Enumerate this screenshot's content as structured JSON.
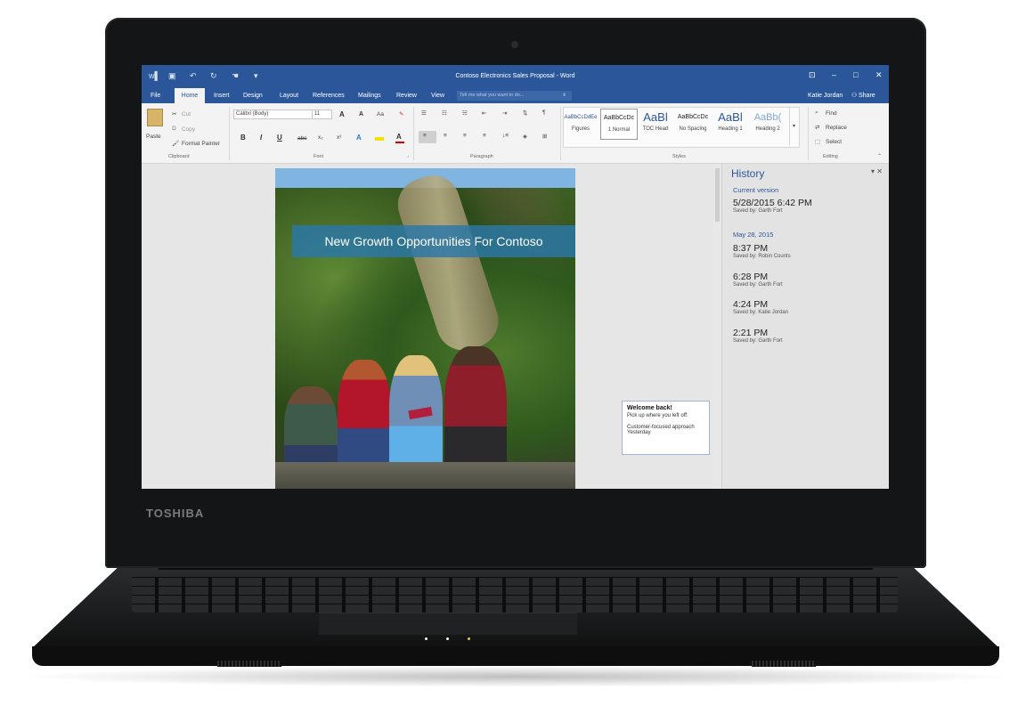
{
  "device": {
    "brand": "TOSHIBA"
  },
  "word": {
    "window_title": "Contoso Electronics Sales Proposal - Word",
    "user_name": "Katie Jordan",
    "share_label": "Share",
    "tabs": [
      {
        "label": "File"
      },
      {
        "label": "Home"
      },
      {
        "label": "Insert"
      },
      {
        "label": "Design"
      },
      {
        "label": "Layout"
      },
      {
        "label": "References"
      },
      {
        "label": "Mailings"
      },
      {
        "label": "Review"
      },
      {
        "label": "View"
      }
    ],
    "tell_me_placeholder": "Tell me what you want to do...",
    "ribbon": {
      "clipboard": {
        "label": "Clipboard",
        "paste": "Paste",
        "cut": "Cut",
        "copy": "Copy",
        "format_painter": "Format Painter"
      },
      "font": {
        "label": "Font",
        "font_name": "Calibri (Body)",
        "font_size": "11",
        "bold": "B",
        "italic": "I",
        "underline": "U",
        "strikethrough": "abc",
        "subscript": "x₂",
        "superscript": "x²",
        "grow": "A",
        "shrink": "A",
        "change_case": "Aa",
        "text_effects": "A",
        "font_color": "A"
      },
      "paragraph": {
        "label": "Paragraph"
      },
      "styles": {
        "label": "Styles",
        "items": [
          {
            "sample": "AaBbCcDdEe",
            "name": "Figures"
          },
          {
            "sample": "AaBbCcDc",
            "name": "1 Normal"
          },
          {
            "sample": "AaBl",
            "name": "TOC Head"
          },
          {
            "sample": "AaBbCcDc",
            "name": "No Spacing"
          },
          {
            "sample": "AaBl",
            "name": "Heading 1"
          },
          {
            "sample": "AaBb(",
            "name": "Heading 2"
          }
        ]
      },
      "editing": {
        "label": "Editing",
        "find": "Find",
        "replace": "Replace",
        "select": "Select"
      }
    },
    "document": {
      "headline": "New Growth Opportunities For Contoso"
    },
    "welcome_callout": {
      "title": "Welcome back!",
      "subtitle": "Pick up where you left off:",
      "item": "Customer-focused approach",
      "when": "Yesterday"
    },
    "history": {
      "title": "History",
      "current_label": "Current version",
      "current": {
        "time": "5/28/2015 6:42 PM",
        "by": "Saved by: Garth Fort"
      },
      "date_header": "May 28, 2015",
      "versions": [
        {
          "time": "8:37 PM",
          "by": "Saved by: Robin Counts"
        },
        {
          "time": "6:28 PM",
          "by": "Saved by: Garth Fort"
        },
        {
          "time": "4:24 PM",
          "by": "Saved by: Katie Jordan"
        },
        {
          "time": "2:21 PM",
          "by": "Saved by: Garth Fort"
        }
      ]
    }
  }
}
